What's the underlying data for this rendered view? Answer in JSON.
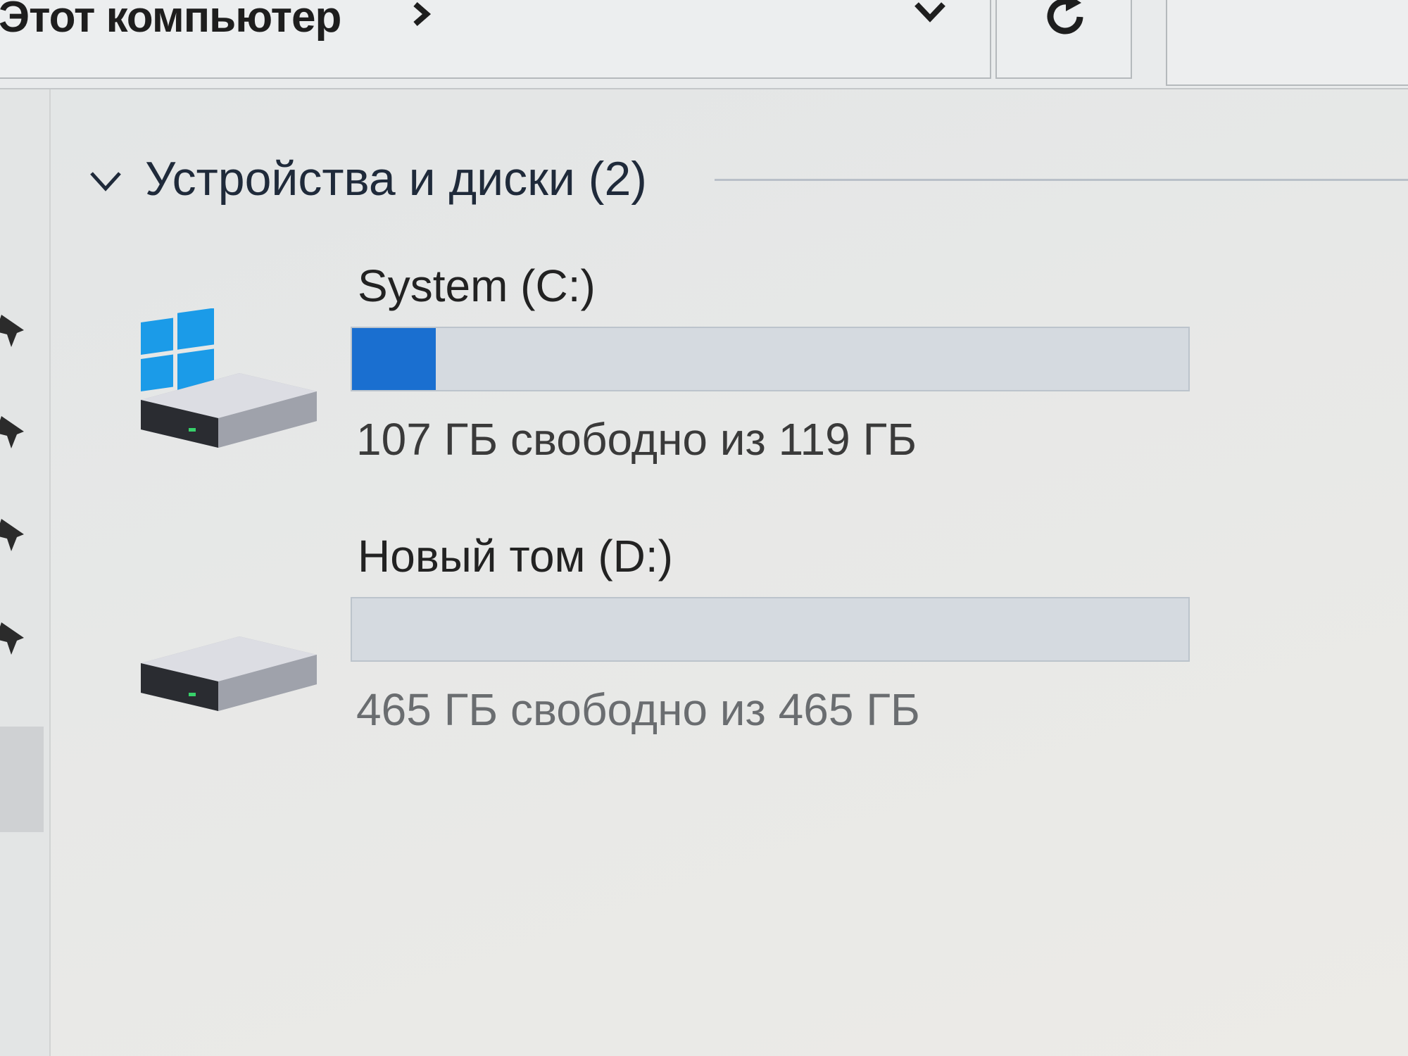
{
  "address_bar": {
    "breadcrumb": "Этот компьютер"
  },
  "section": {
    "title": "Устройства и диски (2)"
  },
  "drives": [
    {
      "name": "System (C:)",
      "free_text": "107 ГБ свободно из 119 ГБ",
      "free_gb": 107,
      "total_gb": 119,
      "used_fraction": 0.1,
      "icon": "windows-drive-icon"
    },
    {
      "name": "Новый том (D:)",
      "free_text": "465 ГБ свободно из 465 ГБ",
      "free_gb": 465,
      "total_gb": 465,
      "used_fraction": 0.0,
      "icon": "hard-drive-icon"
    }
  ],
  "colors": {
    "bar_fill": "#1a6fd0",
    "bar_track": "#d5dae0",
    "windows_logo": "#1b9be8"
  }
}
